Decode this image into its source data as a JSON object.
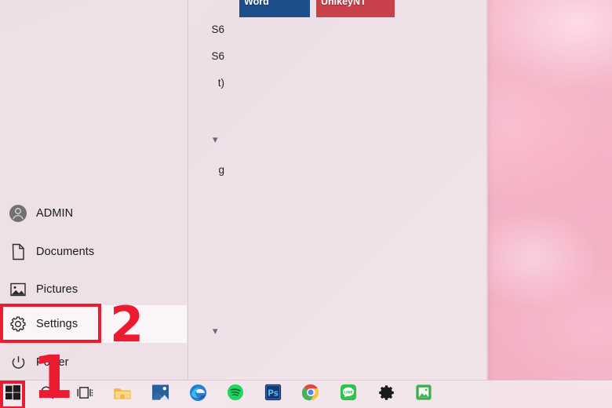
{
  "os": {
    "name": "Windows 10 Start Menu",
    "accent_annotation_color": "#ed1b2f",
    "taskbar_bg": "#f3e6ec",
    "start_menu_bg": "#eee2e8",
    "wallpaper_color": "#f4b6c8"
  },
  "start_menu": {
    "rail_items": [
      {
        "label": "ADMIN",
        "icon": "user-avatar-icon",
        "name": "user-account"
      },
      {
        "label": "Documents",
        "icon": "document-icon",
        "name": "documents"
      },
      {
        "label": "Pictures",
        "icon": "pictures-icon",
        "name": "pictures"
      },
      {
        "label": "Settings",
        "icon": "gear-icon",
        "name": "settings"
      },
      {
        "label": "Power",
        "icon": "power-icon",
        "name": "power"
      }
    ],
    "app_list_fragments": [
      {
        "text": "S6"
      },
      {
        "text": "S6"
      },
      {
        "text": "t)"
      },
      {
        "text": "g"
      }
    ],
    "group_chevrons": 2,
    "tiles": [
      {
        "label": "Word",
        "color": "#1f4e8c"
      },
      {
        "label": "UnikeyNT",
        "color": "#c8414b"
      }
    ]
  },
  "taskbar": {
    "items": [
      {
        "name": "start-button",
        "icon": "windows-logo-icon"
      },
      {
        "name": "search",
        "icon": "search-icon"
      },
      {
        "name": "task-view",
        "icon": "task-view-icon"
      },
      {
        "name": "file-explorer",
        "icon": "folder-icon"
      },
      {
        "name": "photos",
        "icon": "photos-icon"
      },
      {
        "name": "microsoft-edge",
        "icon": "edge-icon"
      },
      {
        "name": "spotify",
        "icon": "spotify-icon"
      },
      {
        "name": "adobe-photoshop",
        "icon": "photoshop-icon"
      },
      {
        "name": "google-chrome",
        "icon": "chrome-icon"
      },
      {
        "name": "line",
        "icon": "line-icon"
      },
      {
        "name": "settings-app",
        "icon": "gear-icon"
      },
      {
        "name": "image-viewer",
        "icon": "green-image-app-icon"
      }
    ]
  },
  "annotations": {
    "step_one": "1",
    "step_two": "2"
  }
}
